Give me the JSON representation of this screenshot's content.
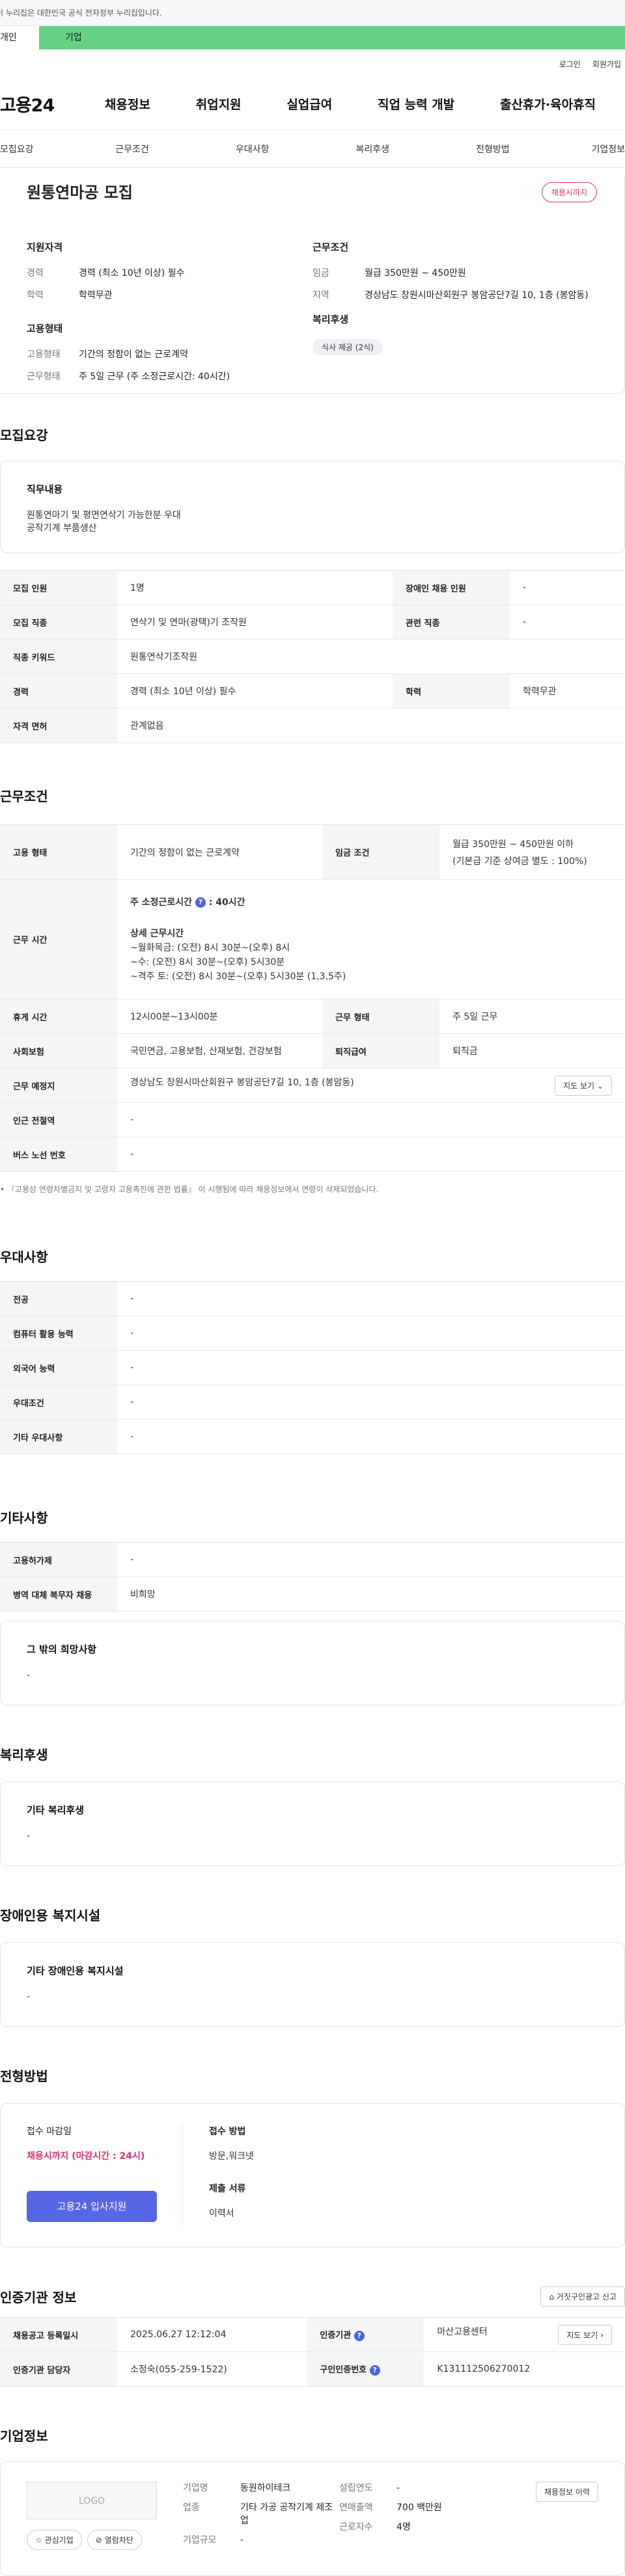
{
  "gov_bar": "이 누리집은 대한민국 공식 전자정부 누리집입니다.",
  "tabs": [
    "개인",
    "기업"
  ],
  "util": [
    "로그인",
    "회원가입"
  ],
  "logo": "고용24",
  "gnb": [
    "채용정보",
    "취업지원",
    "실업급여",
    "직업 능력 개발",
    "출산휴가·육아휴직"
  ],
  "subnav": [
    "모집요강",
    "근무조건",
    "우대사항",
    "복리후생",
    "전형방법",
    "기업정보"
  ],
  "summary": {
    "title": "원통연마공 모집",
    "badge": "채용시까지",
    "qual_title": "지원자격",
    "qual": [
      {
        "k": "경력",
        "v": "경력 (최소 10년 이상) 필수"
      },
      {
        "k": "학력",
        "v": "학력무관"
      }
    ],
    "emp_title": "고용형태",
    "emp": [
      {
        "k": "고용형태",
        "v": "기간의 정함이 없는 근로계약"
      },
      {
        "k": "근무형태",
        "v": "주 5일 근무 (주 소정근로시간: 40시간)"
      }
    ],
    "cond_title": "근무조건",
    "cond": [
      {
        "k": "임금",
        "v": "월급 350만원 ~ 450만원"
      },
      {
        "k": "지역",
        "v": "경상남도 창원시마산회원구 봉암공단7길 10, 1층 (봉암동)"
      }
    ],
    "welfare_title": "복리후생",
    "welfare_chip": "식사 제공 (2식)"
  },
  "recruit": {
    "title": "모집요강",
    "duty_title": "직무내용",
    "duty_lines": [
      "원통연마기 및 평면연삭기 가능한분 우대",
      "공작기계 부품생산"
    ],
    "rows": [
      [
        "모집 인원",
        "1명",
        "장애인 채용 인원",
        "-"
      ],
      [
        "모집 직종",
        "연삭기 및 연마(광택)기 조작원",
        "관련 직종",
        "-"
      ],
      [
        "직종 키워드",
        "원통연삭기조작원"
      ],
      [
        "경력",
        "경력 (최소 10년 이상) 필수",
        "학력",
        "학력무관"
      ],
      [
        "자격 면허",
        "관계없음"
      ]
    ]
  },
  "work": {
    "title": "근무조건",
    "emp_type_label": "고용 형태",
    "emp_type": "기간의 정함이 없는 근로계약",
    "wage_label": "임금 조건",
    "wage_line1": "월급 350만원 ~ 450만원 이하",
    "wage_line2": "(기본급 기준 상여금 별도 : 100%)",
    "hours_label": "근무 시간",
    "hours_week": "주 소정근로시간",
    "hours_week_val": "40시간",
    "hours_detail_title": "상세 근무시간",
    "hours_detail": [
      "~월화목금: (오전) 8시 30분~(오후) 8시",
      "~수: (오전) 8시 30분~(오후) 5시30분",
      "~격주 토: (오전) 8시 30분~(오후) 5시30분 (1,3,5주)"
    ],
    "break_label": "휴게 시간",
    "break_val": "12시00분~13시00분",
    "shape_label": "근무 형태",
    "shape_val": "주 5일 근무",
    "ins_label": "사회보험",
    "ins_val": "국민연금, 고용보험, 산재보험, 건강보험",
    "retire_label": "퇴직급여",
    "retire_val": "퇴직금",
    "place_label": "근무 예정지",
    "place_val": "경상남도 창원시마산회원구 봉암공단7길 10, 1층 (봉암동)",
    "map_btn": "지도 보기",
    "station_label": "인근 전철역",
    "station_val": "-",
    "bus_label": "버스 노선 번호",
    "bus_val": "-",
    "note": "『고용상 연령차별금지 및 고령자 고용촉진에 관한 법률』 이 시행됨에 따라 채용정보에서 연령이 삭제되었습니다."
  },
  "pref": {
    "title": "우대사항",
    "rows": [
      [
        "전공",
        "-"
      ],
      [
        "컴퓨터 활용 능력",
        "-"
      ],
      [
        "외국어 능력",
        "-"
      ],
      [
        "우대조건",
        "-"
      ],
      [
        "기타 우대사항",
        "-"
      ]
    ]
  },
  "etc": {
    "title": "기타사항",
    "rows": [
      [
        "고용허가제",
        "-"
      ],
      [
        "병역 대체 복무자 채용",
        "비희망"
      ]
    ],
    "wish_title": "그 밖의 희망사항",
    "wish_val": "-"
  },
  "welfare": {
    "title": "복리후생",
    "box_title": "기타 복리후생",
    "box_val": "-"
  },
  "disabled": {
    "title": "장애인용 복지시설",
    "box_title": "기타 장애인용 복지시설",
    "box_val": "-"
  },
  "process": {
    "title": "전형방법",
    "deadline_title": "접수 마감일",
    "deadline_val": "채용시까지 (마감시간 : 24시)",
    "apply_btn": "고용24 입사지원",
    "method_title": "접수 방법",
    "method_val": "방문,워크넷",
    "docs_title": "제출 서류",
    "docs_val": "이력서"
  },
  "cert": {
    "title": "인증기관 정보",
    "report_btn": "거짓구인광고 신고",
    "rows": [
      [
        "채용공고 등록일시",
        "2025.06.27 12:12:04",
        "인증기관",
        "마산고용센터"
      ],
      [
        "인증기관 담당자",
        "소정숙(055-259-1522)",
        "구인인증번호",
        "K131112506270012"
      ]
    ],
    "detail_btn": "지도 보기"
  },
  "company": {
    "title": "기업정보",
    "logo_text": "LOGO",
    "fav_btn": "관심기업",
    "block_btn": "열람차단",
    "name_label": "기업명",
    "name_val": "동원하이테크",
    "ind_label": "업종",
    "ind_val": "기타 가공 공작기계 제조업",
    "size_label": "기업규모",
    "size_val": "-",
    "year_label": "설립연도",
    "year_val": "-",
    "sales_label": "연매출액",
    "sales_val": "700 백만원",
    "emp_label": "근로자수",
    "emp_val": "4명",
    "history_btn": "채용정보 이력"
  }
}
